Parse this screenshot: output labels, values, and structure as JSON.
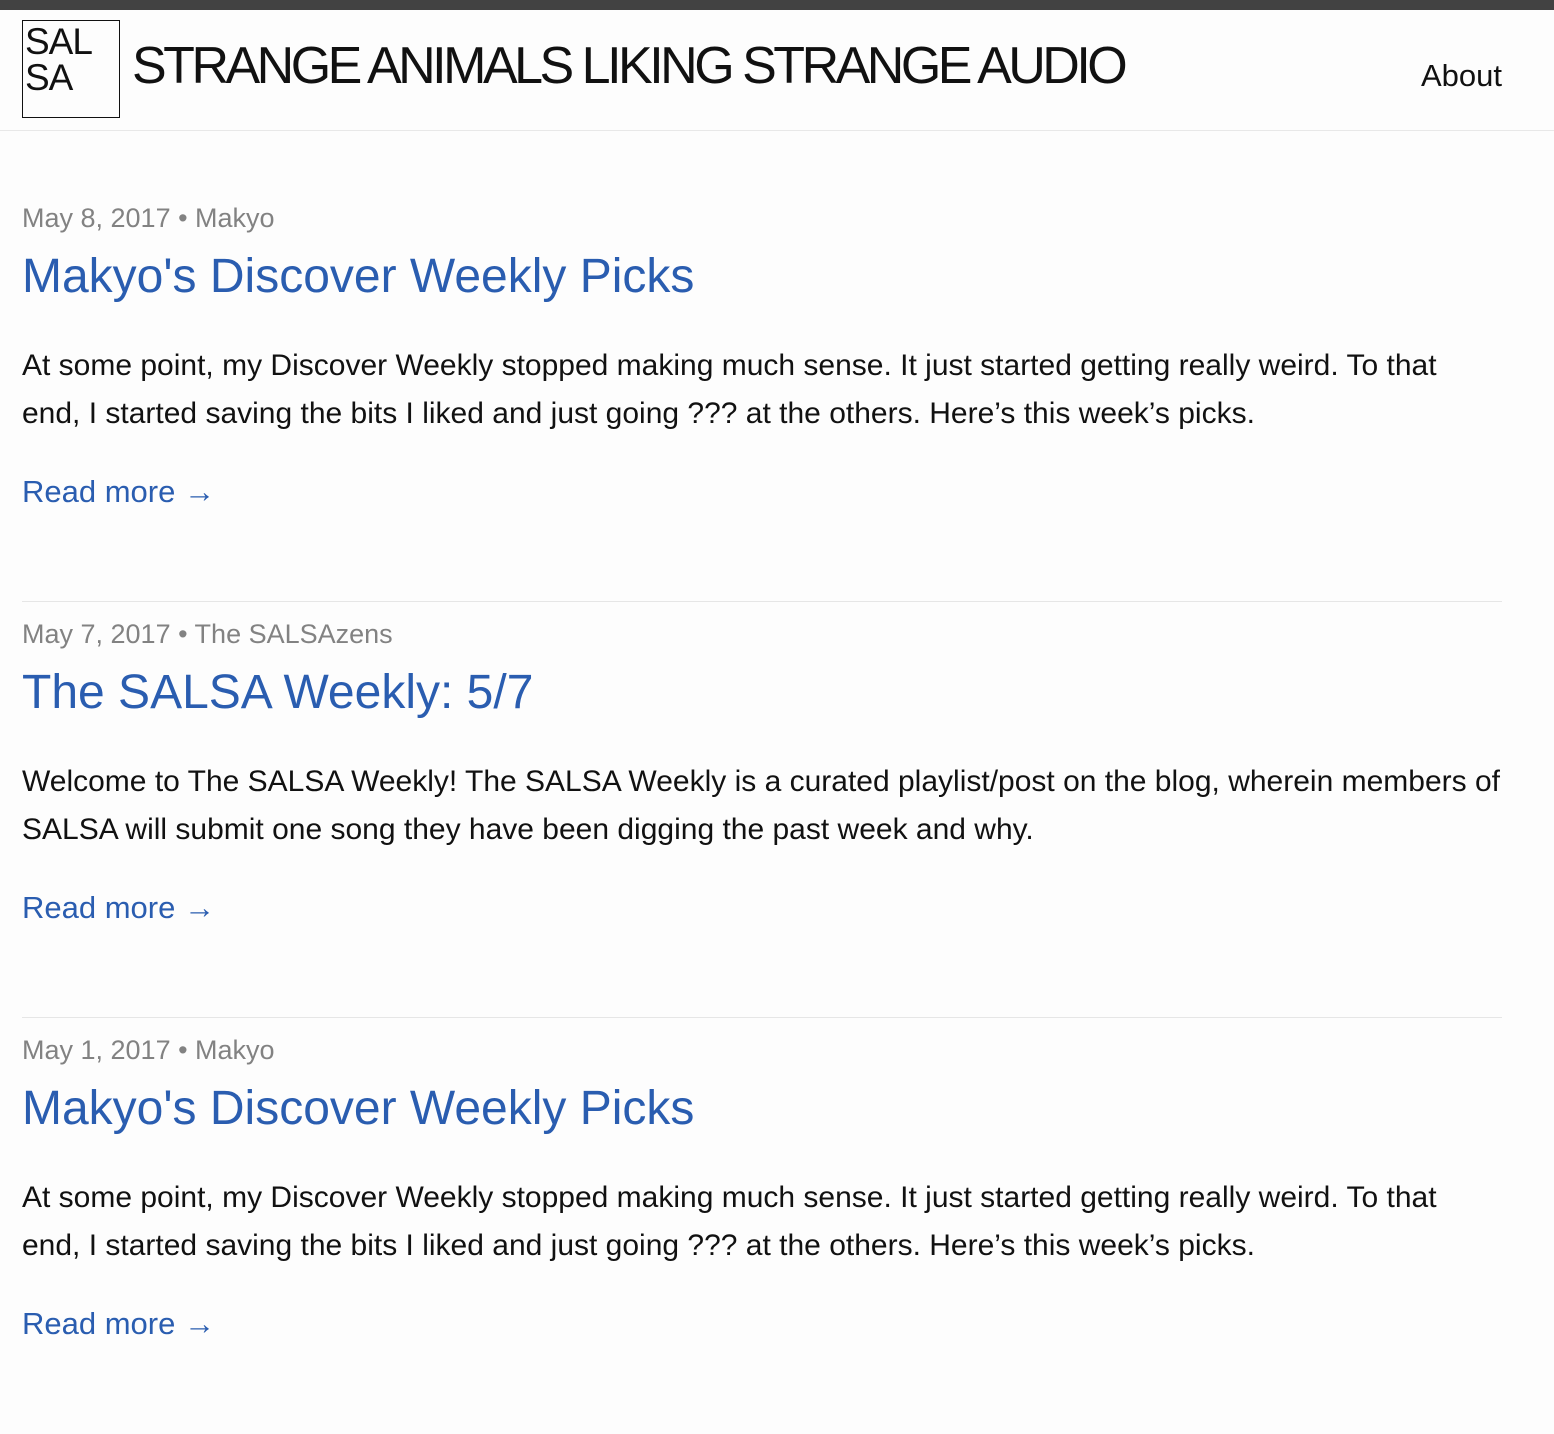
{
  "colors": {
    "top_bar": "#424242",
    "link": "#2a5db0",
    "meta": "#828282",
    "text": "#111111",
    "background": "#fdfdfd"
  },
  "header": {
    "logo_line1": "SAL",
    "logo_line2": "SA",
    "site_title": "STRANGE ANIMALS LIKING STRANGE AUDIO",
    "nav": {
      "about": "About"
    }
  },
  "posts": [
    {
      "meta": "May 8, 2017 • Makyo",
      "title": "Makyo's Discover Weekly Picks",
      "excerpt": "At some point, my Discover Weekly stopped making much sense. It just started getting really weird. To that end, I started saving the bits I liked and just going ??? at the others. Here’s this week’s picks.",
      "read_more": "Read more →"
    },
    {
      "meta": "May 7, 2017 • The SALSAzens",
      "title": "The SALSA Weekly: 5/7",
      "excerpt": "Welcome to The SALSA Weekly! The SALSA Weekly is a curated playlist/post on the blog, wherein members of SALSA will submit one song they have been digging the past week and why.",
      "read_more": "Read more →"
    },
    {
      "meta": "May 1, 2017 • Makyo",
      "title": "Makyo's Discover Weekly Picks",
      "excerpt": "At some point, my Discover Weekly stopped making much sense. It just started getting really weird. To that end, I started saving the bits I liked and just going ??? at the others. Here’s this week’s picks.",
      "read_more": "Read more →"
    }
  ]
}
